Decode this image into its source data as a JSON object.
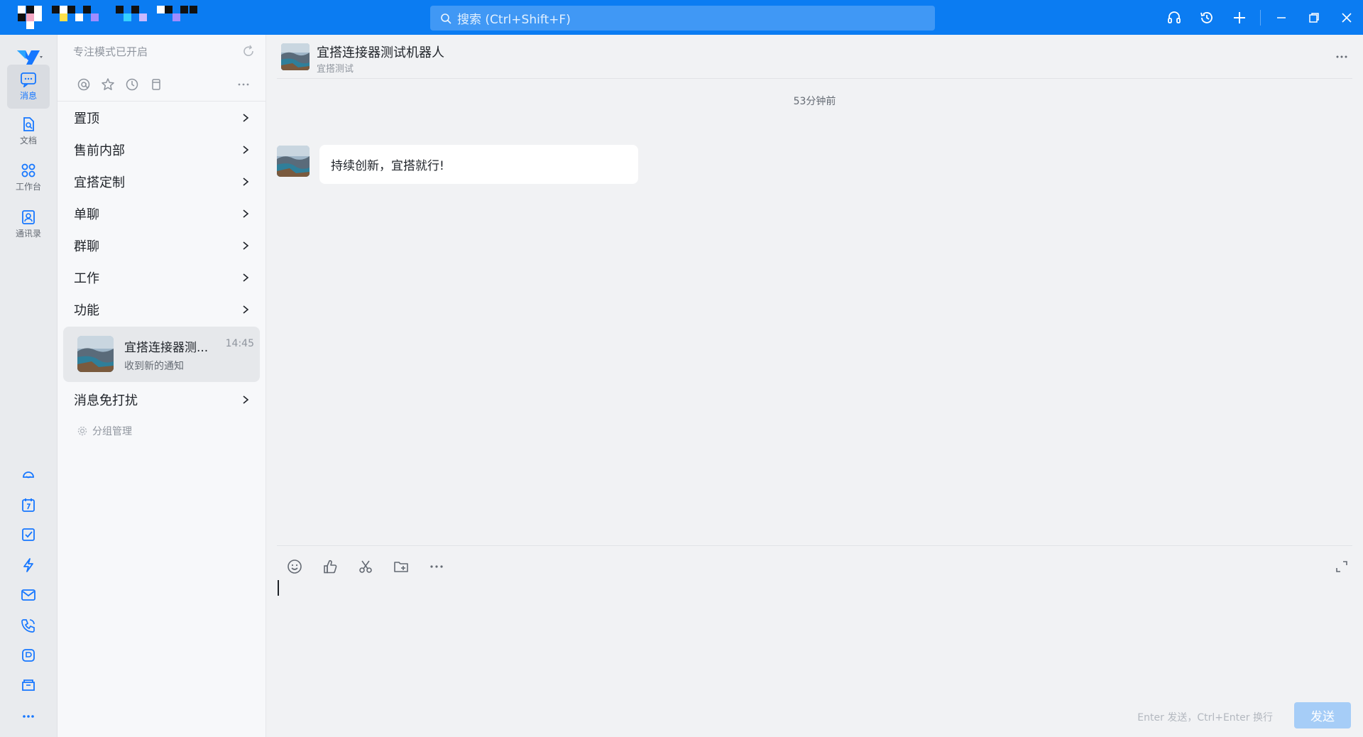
{
  "search": {
    "placeholder": "搜索 (Ctrl+Shift+F)"
  },
  "rail": {
    "items": [
      {
        "label": "消息",
        "icon": "message-icon"
      },
      {
        "label": "文档",
        "icon": "document-icon"
      },
      {
        "label": "工作台",
        "icon": "workbench-icon"
      },
      {
        "label": "通讯录",
        "icon": "contacts-icon"
      }
    ]
  },
  "sidebar": {
    "focus_mode": "专注模式已开启",
    "groups_top": [
      "置顶",
      "售前内部",
      "宜搭定制",
      "单聊",
      "群聊",
      "工作",
      "功能"
    ],
    "chat": {
      "name": "宜搭连接器测...",
      "time": "14:45",
      "preview": "收到新的通知"
    },
    "groups_bottom": [
      "消息免打扰"
    ],
    "group_mgmt": "分组管理"
  },
  "conversation": {
    "title": "宜搭连接器测试机器人",
    "subtitle": "宜搭测试",
    "timestamp": "53分钟前",
    "messages": [
      {
        "text": "持续创新，宜搭就行!"
      }
    ]
  },
  "composer": {
    "hint": "Enter 发送，Ctrl+Enter 换行",
    "send_label": "发送"
  },
  "colors": {
    "accent": "#0b7cf2",
    "send_disabled": "#a6cdf7"
  }
}
